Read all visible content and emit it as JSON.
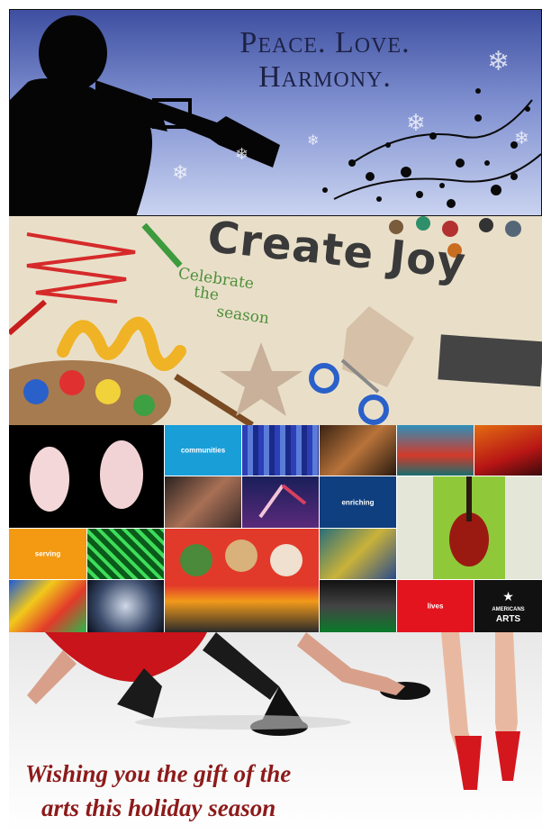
{
  "panel1": {
    "title_line1": "Peace. Love.",
    "title_line2": "Harmony."
  },
  "panel2": {
    "title": "Create Joy",
    "subtitle_line1": "Celebrate",
    "subtitle_line2": "the",
    "subtitle_line3": "season"
  },
  "panel3": {
    "tiles": {
      "communities": "communities",
      "enriching": "enriching",
      "serving": "serving",
      "lives": "lives",
      "logo_line1": "AMERICANS",
      "logo_line2": "ARTS"
    },
    "colors": {
      "blue": "#1a9ed8",
      "navy": "#0f3f7e",
      "orange": "#f49a12",
      "red": "#e4141e",
      "black": "#111111"
    }
  },
  "panel4": {
    "message_line1": "Wishing you the gift of the",
    "message_line2": "arts this holiday season"
  }
}
